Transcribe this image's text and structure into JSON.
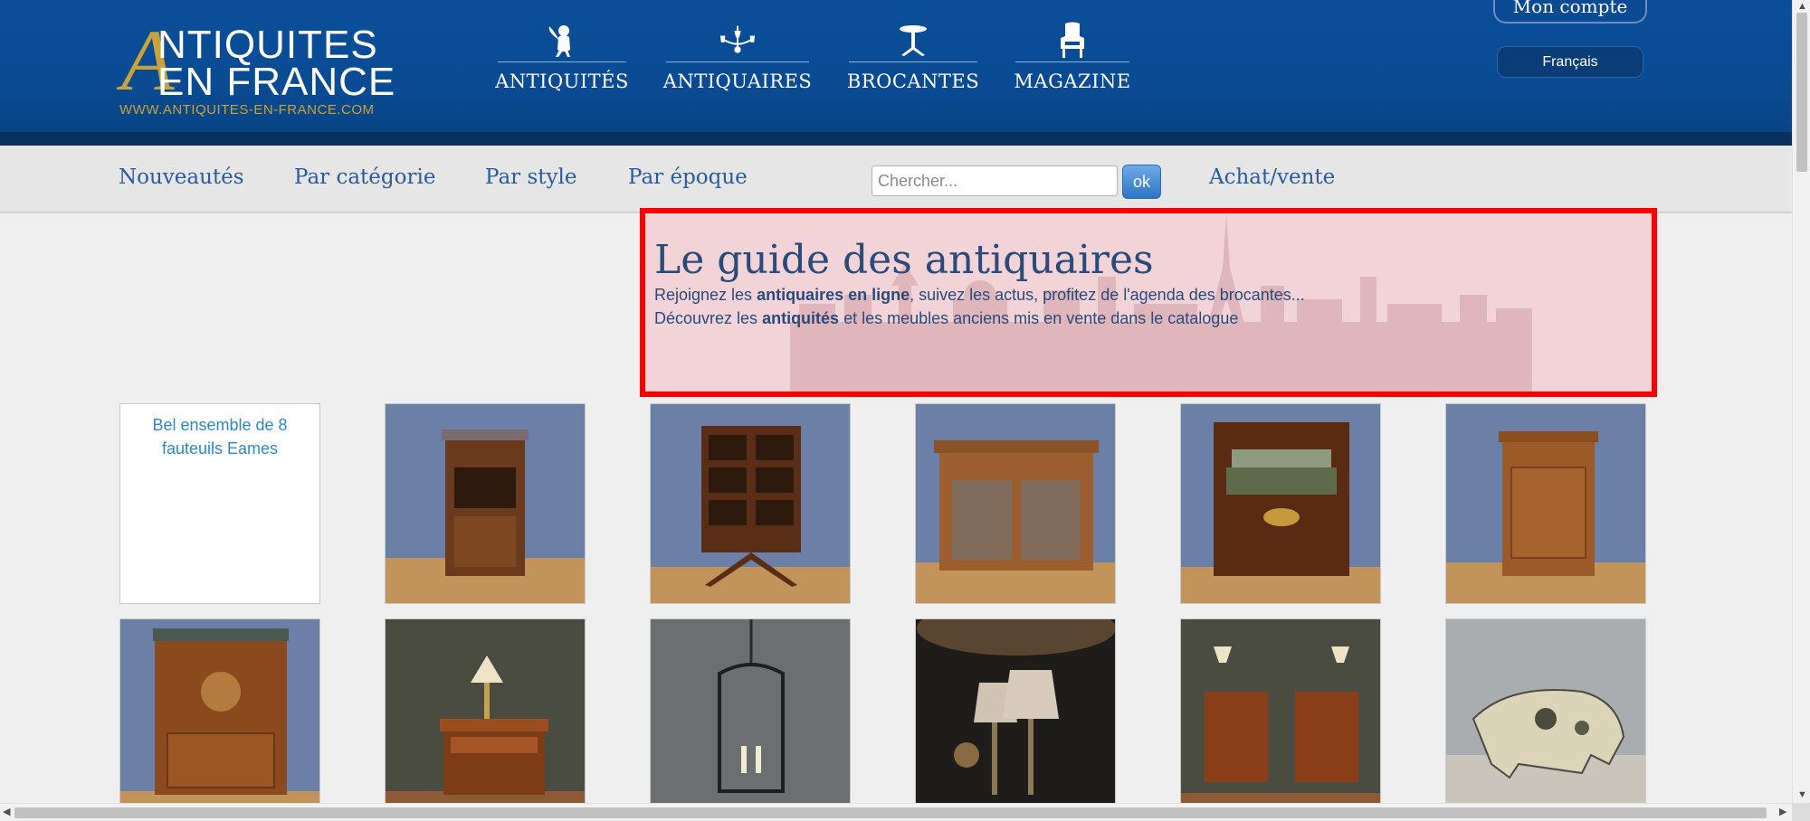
{
  "logo": {
    "line1": "NTIQUITES",
    "line2": "EN FRANCE",
    "big_letter": "A",
    "url": "WWW.ANTIQUITES-EN-FRANCE.COM"
  },
  "main_nav": [
    {
      "label": "ANTIQUITÉS",
      "icon": "cherub-icon"
    },
    {
      "label": "ANTIQUAIRES",
      "icon": "chandelier-icon"
    },
    {
      "label": "BROCANTES",
      "icon": "pedestal-table-icon"
    },
    {
      "label": "MAGAZINE",
      "icon": "armchair-icon"
    }
  ],
  "account": {
    "label": "Mon compte",
    "language": "Français"
  },
  "subnav": {
    "links": [
      "Nouveautés",
      "Par catégorie",
      "Par style",
      "Par époque"
    ],
    "search_placeholder": "Chercher...",
    "search_button": "ok",
    "achat_vente": "Achat/vente"
  },
  "intro": {
    "title": "Le guide des antiquaires",
    "line1_a": "Rejoignez les ",
    "line1_b": "antiquaires en ligne",
    "line1_c": ", suivez les actus, profitez de l'agenda des brocantes...",
    "line2_a": "Découvrez les ",
    "line2_b": "antiquités",
    "line2_c": " et les meubles anciens mis en vente dans le catalogue"
  },
  "products": [
    {
      "alt": "Bel ensemble de 8 fauteuils Eames",
      "image": "broken"
    },
    {
      "image": "nightstand-marble"
    },
    {
      "image": "revolving-bookcase"
    },
    {
      "image": "glazed-buffet"
    },
    {
      "image": "single-bed"
    },
    {
      "image": "small-cabinet"
    },
    {
      "image": "secretary-desk"
    },
    {
      "image": "bedside-table"
    },
    {
      "image": "lantern"
    },
    {
      "image": "lamps-pair"
    },
    {
      "image": "pair-of-nightstands"
    },
    {
      "image": "bull-sculpture"
    }
  ],
  "colors": {
    "header_blue": "#0a4b93",
    "gold": "#c9a23a",
    "link_blue": "#2a5b9c",
    "highlight_border": "#ff0000"
  }
}
